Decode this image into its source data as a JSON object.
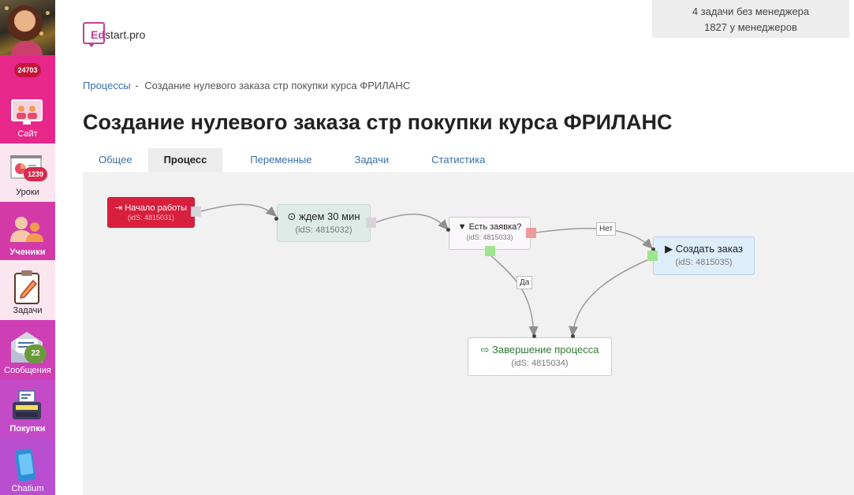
{
  "sidebar": {
    "top_badge": "24703",
    "items": [
      {
        "label": "Сайт",
        "icon": "site-icon",
        "badge": ""
      },
      {
        "label": "Уроки",
        "icon": "lessons-icon",
        "badge": "1239"
      },
      {
        "label": "Ученики",
        "icon": "students-icon",
        "badge": ""
      },
      {
        "label": "Задачи",
        "icon": "tasks-icon",
        "badge": ""
      },
      {
        "label": "Сообщения",
        "icon": "messages-icon",
        "badge": "22"
      },
      {
        "label": "Покупки",
        "icon": "purchases-icon",
        "badge": ""
      },
      {
        "label": "Chatium",
        "icon": "chatium-icon",
        "badge": ""
      }
    ]
  },
  "logo": {
    "ed": "Ed",
    "rest": "start.pro"
  },
  "info": {
    "line1": "4 задачи без менеджера",
    "line2": "1827 у менеджеров"
  },
  "breadcrumb": {
    "parent": "Процессы",
    "sep": "-",
    "current": "Создание нулевого заказа стр покупки курса ФРИЛАНС"
  },
  "page_title": "Создание нулевого заказа стр покупки курса ФРИЛАНС",
  "tabs": [
    {
      "label": "Общее",
      "active": false
    },
    {
      "label": "Процесс",
      "active": true
    },
    {
      "label": "Переменные",
      "active": false
    },
    {
      "label": "Задачи",
      "active": false
    },
    {
      "label": "Статистика",
      "active": false
    }
  ],
  "flow": {
    "nodes": {
      "start": {
        "title": "Начало работы",
        "ids": "(idS: 4815031)",
        "icon": "sign-in-icon"
      },
      "wait": {
        "title": "ждем 30 мин",
        "ids": "(idS: 4815032)",
        "icon": "clock-icon"
      },
      "check": {
        "title": "Есть заявка?",
        "ids": "(idS: 4815033)",
        "icon": "filter-icon"
      },
      "create": {
        "title": "Создать заказ",
        "ids": "(idS: 4815035)",
        "icon": "play-icon"
      },
      "finish": {
        "title": "Завершение процесса",
        "ids": "(idS: 4815034)",
        "icon": "sign-out-icon"
      }
    },
    "edge_labels": {
      "no": "Нет",
      "yes": "Да"
    }
  },
  "colors": {
    "sidebar_pink": "#e8278a",
    "sidebar_purple": "#c44bc8",
    "start_node": "#d81f3e",
    "wait_node": "#deebe6",
    "create_node": "#deedfa",
    "finish_text": "#2f7a2f",
    "link": "#3a6fa8"
  }
}
